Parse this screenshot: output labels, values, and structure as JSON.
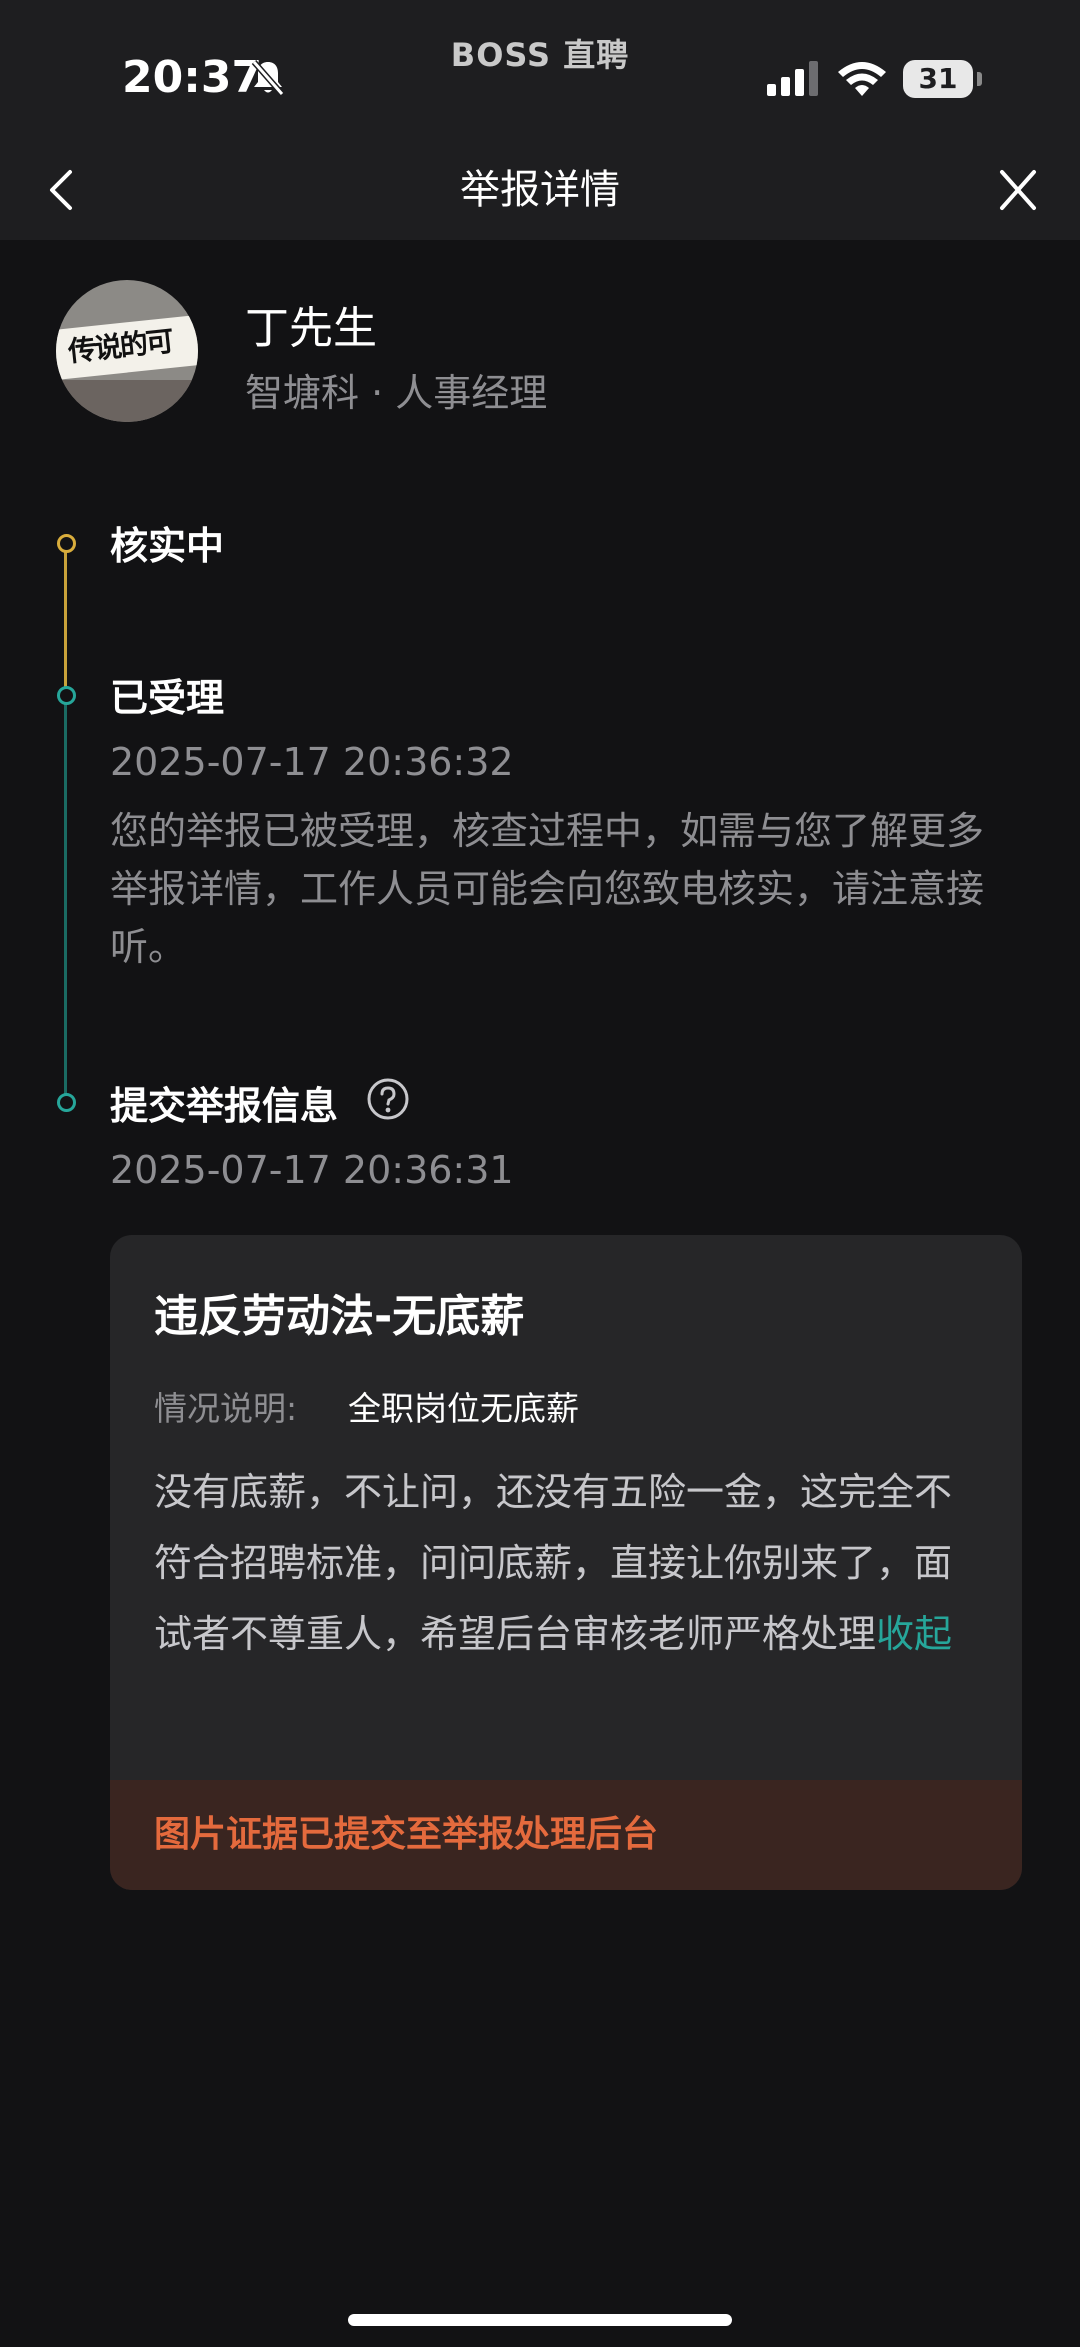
{
  "status_bar": {
    "time": "20:37",
    "app_label": "BOSS 直聘",
    "battery": "31",
    "icons": [
      "bell-slash-icon",
      "signal-icon",
      "wifi-icon",
      "battery-icon"
    ]
  },
  "nav": {
    "title": "举报详情",
    "back_icon": "chevron-left-icon",
    "close_icon": "close-icon"
  },
  "profile": {
    "name": "丁先生",
    "subtitle": "智塘科 · 人事经理",
    "avatar_text": "传说的可"
  },
  "timeline": {
    "colors": {
      "current": "#d9ad3c",
      "done": "#26a69a"
    },
    "steps": [
      {
        "title": "核实中"
      },
      {
        "title": "已受理",
        "time": "2025-07-17 20:36:32",
        "desc": "您的举报已被受理，核查过程中，如需与您了解更多举报详情，工作人员可能会向您致电核实，请注意接听。"
      },
      {
        "title": "提交举报信息",
        "time": "2025-07-17 20:36:31",
        "help_icon": "question-circle-icon"
      }
    ]
  },
  "report_card": {
    "title": "违反劳动法-无底薪",
    "detail_label": "情况说明:",
    "detail_value": "全职岗位无底薪",
    "detail_text": "没有底薪，不让问，还没有五险一金，这完全不符合招聘标准，问问底薪，直接让你别来了，面试者不尊重人，希望后台审核老师严格处理",
    "collapse_label": "收起",
    "evidence_note": "图片证据已提交至举报处理后台"
  }
}
